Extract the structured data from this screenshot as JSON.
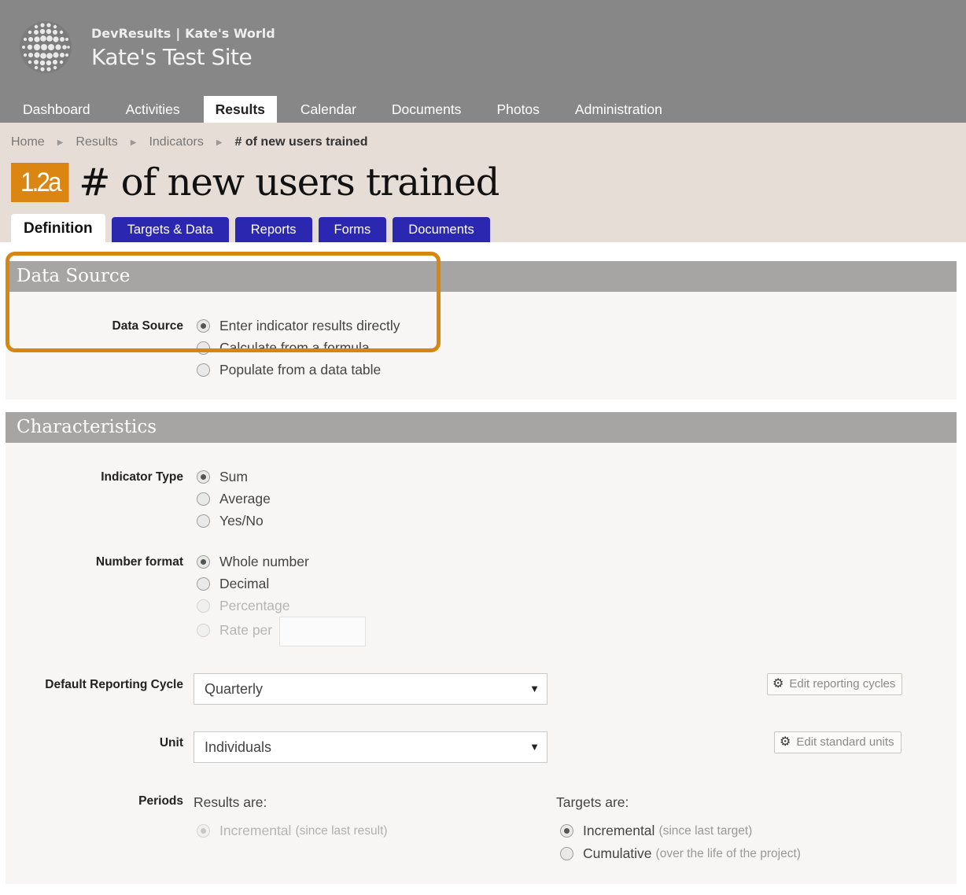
{
  "header": {
    "org_name": "DevResults",
    "org_separator": "|",
    "workspace": "Kate's World",
    "site_title": "Kate's Test Site",
    "nav": [
      {
        "label": "Dashboard"
      },
      {
        "label": "Activities"
      },
      {
        "label": "Results",
        "active": true
      },
      {
        "label": "Calendar"
      },
      {
        "label": "Documents"
      },
      {
        "label": "Photos"
      },
      {
        "label": "Administration"
      }
    ]
  },
  "breadcrumb": [
    "Home",
    "Results",
    "Indicators",
    "# of new users trained"
  ],
  "indicator": {
    "code": "1.2a",
    "title": "# of new users trained"
  },
  "tabs": [
    {
      "label": "Definition",
      "active": true
    },
    {
      "label": "Targets & Data"
    },
    {
      "label": "Reports"
    },
    {
      "label": "Forms"
    },
    {
      "label": "Documents"
    }
  ],
  "data_source": {
    "heading": "Data Source",
    "label": "Data Source",
    "options": [
      {
        "label": "Enter indicator results directly",
        "selected": true
      },
      {
        "label": "Calculate from a formula"
      },
      {
        "label": "Populate from a data table"
      }
    ]
  },
  "characteristics": {
    "heading": "Characteristics",
    "indicator_type": {
      "label": "Indicator Type",
      "options": [
        {
          "label": "Sum",
          "selected": true
        },
        {
          "label": "Average"
        },
        {
          "label": "Yes/No"
        }
      ]
    },
    "number_format": {
      "label": "Number format",
      "options": [
        {
          "label": "Whole number",
          "selected": true
        },
        {
          "label": "Decimal"
        },
        {
          "label": "Percentage",
          "disabled": true
        },
        {
          "label": "Rate per",
          "disabled": true
        }
      ]
    },
    "reporting_cycle": {
      "label": "Default Reporting Cycle",
      "value": "Quarterly",
      "edit_button": "Edit reporting cycles"
    },
    "unit": {
      "label": "Unit",
      "value": "Individuals",
      "edit_button": "Edit standard units"
    },
    "periods": {
      "label": "Periods",
      "results_label": "Results are:",
      "results_option": {
        "label": "Incremental",
        "hint": "(since last result)"
      },
      "targets_label": "Targets are:",
      "targets_options": [
        {
          "label": "Incremental",
          "hint": "(since last target)",
          "selected": true
        },
        {
          "label": "Cumulative",
          "hint": "(over the life of the project)"
        }
      ]
    }
  },
  "colors": {
    "header_bg": "#878787",
    "band_bg": "#e6ddd6",
    "tab_blue": "#2c27b0",
    "badge_orange": "#db8613",
    "highlight_orange": "#d7860f"
  },
  "icons": {
    "logo": "globe-dots-logo",
    "breadcrumb_separator": "triangle-right-icon",
    "select_caret": "triangle-down-icon",
    "button_icon": "gear-icon"
  }
}
